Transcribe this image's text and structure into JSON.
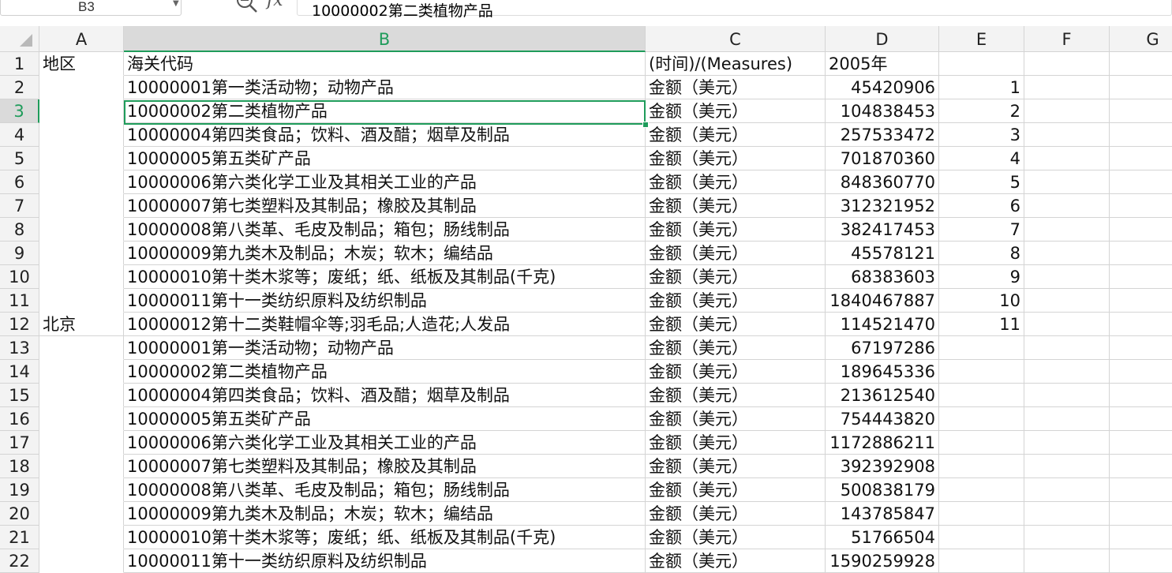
{
  "formula_bar": {
    "name_box": "B3",
    "formula_text": "10000002第二类植物产品",
    "zoom_icon": "zoom-icon",
    "fx_icon": "fx-icon",
    "fx_label": "fx"
  },
  "sheet": {
    "columns": [
      "A",
      "B",
      "C",
      "D",
      "E",
      "F",
      "G"
    ],
    "selected_column": "B",
    "selected_row": 3,
    "rows": [
      {
        "num": "1",
        "a": "地区",
        "b": "海关代码",
        "c": "(时间)/(Measures)",
        "d": "2005年",
        "e": ""
      },
      {
        "num": "2",
        "a": "",
        "b": "10000001第一类活动物；动物产品",
        "c": "金额（美元）",
        "d": "45420906",
        "e": "1"
      },
      {
        "num": "3",
        "a": "",
        "b": "10000002第二类植物产品",
        "c": "金额（美元）",
        "d": "104838453",
        "e": "2"
      },
      {
        "num": "4",
        "a": "",
        "b": "10000004第四类食品；饮料、酒及醋；烟草及制品",
        "c": "金额（美元）",
        "d": "257533472",
        "e": "3"
      },
      {
        "num": "5",
        "a": "",
        "b": "10000005第五类矿产品",
        "c": "金额（美元）",
        "d": "701870360",
        "e": "4"
      },
      {
        "num": "6",
        "a": "",
        "b": "10000006第六类化学工业及其相关工业的产品",
        "c": "金额（美元）",
        "d": "848360770",
        "e": "5"
      },
      {
        "num": "7",
        "a": "",
        "b": "10000007第七类塑料及其制品；橡胶及其制品",
        "c": "金额（美元）",
        "d": "312321952",
        "e": "6"
      },
      {
        "num": "8",
        "a": "",
        "b": "10000008第八类革、毛皮及制品；箱包；肠线制品",
        "c": "金额（美元）",
        "d": "382417453",
        "e": "7"
      },
      {
        "num": "9",
        "a": "",
        "b": "10000009第九类木及制品；木炭；软木；编结品",
        "c": "金额（美元）",
        "d": "45578121",
        "e": "8"
      },
      {
        "num": "10",
        "a": "",
        "b": "10000010第十类木浆等；废纸；纸、纸板及其制品(千克)",
        "c": "金额（美元）",
        "d": "68383603",
        "e": "9"
      },
      {
        "num": "11",
        "a": "",
        "b": "10000011第十一类纺织原料及纺织制品",
        "c": "金额（美元）",
        "d": "1840467887",
        "e": "10"
      },
      {
        "num": "12",
        "a": "北京",
        "b": "10000012第十二类鞋帽伞等;羽毛品;人造花;人发品",
        "c": "金额（美元）",
        "d": "114521470",
        "e": "11"
      },
      {
        "num": "13",
        "a": "",
        "b": "10000001第一类活动物；动物产品",
        "c": "金额（美元）",
        "d": "67197286",
        "e": ""
      },
      {
        "num": "14",
        "a": "",
        "b": "10000002第二类植物产品",
        "c": "金额（美元）",
        "d": "189645336",
        "e": ""
      },
      {
        "num": "15",
        "a": "",
        "b": "10000004第四类食品；饮料、酒及醋；烟草及制品",
        "c": "金额（美元）",
        "d": "213612540",
        "e": ""
      },
      {
        "num": "16",
        "a": "",
        "b": "10000005第五类矿产品",
        "c": "金额（美元）",
        "d": "754443820",
        "e": ""
      },
      {
        "num": "17",
        "a": "",
        "b": "10000006第六类化学工业及其相关工业的产品",
        "c": "金额（美元）",
        "d": "1172886211",
        "e": ""
      },
      {
        "num": "18",
        "a": "",
        "b": "10000007第七类塑料及其制品；橡胶及其制品",
        "c": "金额（美元）",
        "d": "392392908",
        "e": ""
      },
      {
        "num": "19",
        "a": "",
        "b": "10000008第八类革、毛皮及制品；箱包；肠线制品",
        "c": "金额（美元）",
        "d": "500838179",
        "e": ""
      },
      {
        "num": "20",
        "a": "",
        "b": "10000009第九类木及制品；木炭；软木；编结品",
        "c": "金额（美元）",
        "d": "143785847",
        "e": ""
      },
      {
        "num": "21",
        "a": "",
        "b": "10000010第十类木浆等；废纸；纸、纸板及其制品(千克)",
        "c": "金额（美元）",
        "d": "51766504",
        "e": ""
      },
      {
        "num": "22",
        "a": "",
        "b": "10000011第十一类纺织原料及纺织制品",
        "c": "金额（美元）",
        "d": "1590259928",
        "e": ""
      }
    ]
  }
}
